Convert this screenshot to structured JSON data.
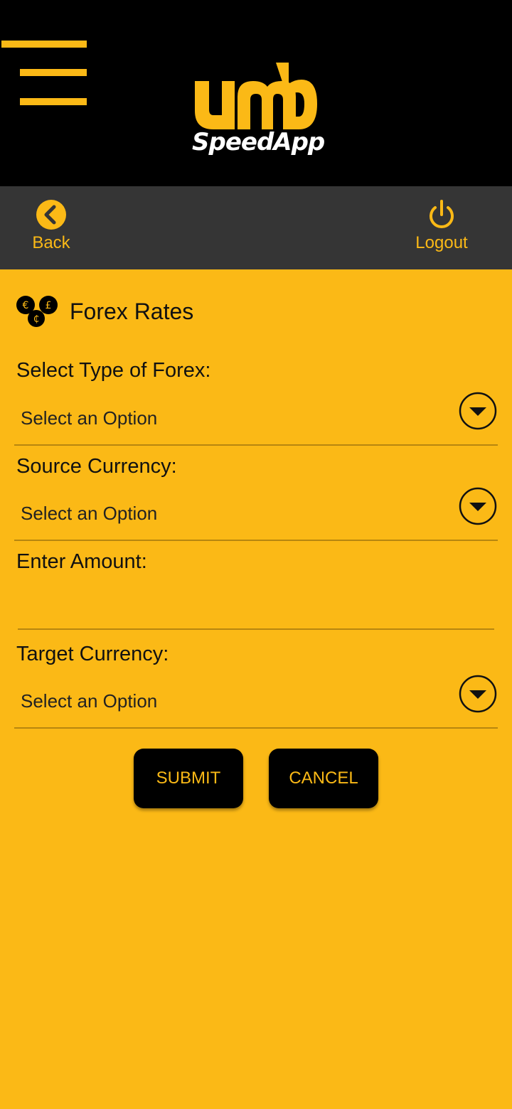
{
  "brand": {
    "logo_top": "umb",
    "logo_bottom": "SpeedApp",
    "accent": "#FBB916",
    "background": "#FBB916",
    "header_bg": "#000000",
    "navbar_bg": "#353535"
  },
  "nav": {
    "back_label": "Back",
    "logout_label": "Logout",
    "back_icon": "chevron-left-circle-icon",
    "logout_icon": "power-icon"
  },
  "page": {
    "title": "Forex Rates",
    "title_icon": "currency-coins-icon"
  },
  "form": {
    "forex_type": {
      "label": "Select Type of Forex:",
      "value": "Select an Option"
    },
    "source_currency": {
      "label": "Source Currency:",
      "value": "Select an Option"
    },
    "amount": {
      "label": "Enter Amount:",
      "value": ""
    },
    "target_currency": {
      "label": "Target Currency:",
      "value": "Select an Option"
    }
  },
  "actions": {
    "submit_label": "SUBMIT",
    "cancel_label": "CANCEL"
  }
}
